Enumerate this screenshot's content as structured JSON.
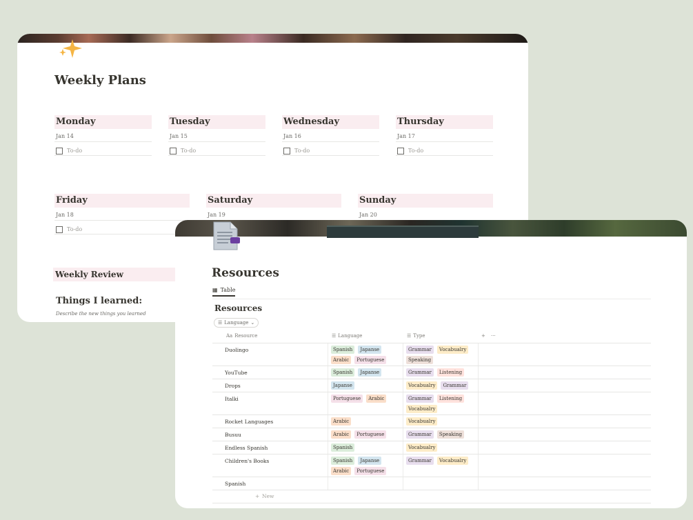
{
  "weekly": {
    "title": "Weekly Plans",
    "days": [
      {
        "name": "Monday",
        "date": "Jan 14",
        "todo": "To-do"
      },
      {
        "name": "Tuesday",
        "date": "Jan 15",
        "todo": "To-do"
      },
      {
        "name": "Wednesday",
        "date": "Jan 16",
        "todo": "To-do"
      },
      {
        "name": "Thursday",
        "date": "Jan 17",
        "todo": "To-do"
      },
      {
        "name": "Friday",
        "date": "Jan 18",
        "todo": "To-do"
      },
      {
        "name": "Saturday",
        "date": "Jan 19"
      },
      {
        "name": "Sunday",
        "date": "Jan 20"
      }
    ],
    "review_label": "Weekly Review",
    "learned_heading": "Things I learned:",
    "learned_placeholder": "Describe the new things you learned"
  },
  "resources": {
    "page_title": "Resources",
    "view_tab": "Table",
    "db_title": "Resources",
    "filter_label": "Language",
    "columns": {
      "name": "Resource",
      "language": "Language",
      "type": "Type",
      "name_icon": "Aa"
    },
    "new_label": "New",
    "rows": [
      {
        "name": "Duolingo",
        "language": [
          "Spanish",
          "Japanse",
          "Arabic",
          "Portuguese"
        ],
        "type": [
          "Grammar",
          "Vocabualry",
          "Speaking"
        ]
      },
      {
        "name": "YouTube",
        "language": [
          "Spanish",
          "Japanse"
        ],
        "type": [
          "Grammar",
          "Listening"
        ]
      },
      {
        "name": "Drops",
        "language": [
          "Japanse"
        ],
        "type": [
          "Vocabualry",
          "Grammar"
        ]
      },
      {
        "name": "Italki",
        "language": [
          "Portuguese",
          "Arabic"
        ],
        "type": [
          "Grammar",
          "Listening",
          "Vocabualry"
        ]
      },
      {
        "name": "Rocket Languages",
        "language": [
          "Arabic"
        ],
        "type": [
          "Vocabualry"
        ]
      },
      {
        "name": "Busuu",
        "language": [
          "Arabic",
          "Portuguese"
        ],
        "type": [
          "Grammar",
          "Speaking"
        ]
      },
      {
        "name": "Endless Spanish",
        "language": [
          "Spanish"
        ],
        "type": [
          "Vocabualry"
        ]
      },
      {
        "name": "Children's Books",
        "language": [
          "Spanish",
          "Japanse",
          "Arabic",
          "Portuguese"
        ],
        "type": [
          "Grammar",
          "Vocabualry"
        ]
      },
      {
        "name": "Spanish",
        "language": [],
        "type": []
      }
    ]
  },
  "tag_colors": {
    "Spanish": "#dbeddb",
    "Japanse": "#d3e5ef",
    "Arabic": "#fadec9",
    "Portuguese": "#f5e0e9",
    "Grammar": "#e8deee",
    "Vocabualry": "#fdecc8",
    "Speaking": "#eee0da",
    "Listening": "#ffe2dd"
  },
  "colors": {
    "day_header_bg": "#faedf0",
    "background": "#dde3d7"
  },
  "icons": {
    "sparkle": "sparkle-icon",
    "document": "document-icon",
    "table": "table-icon",
    "list": "list-icon"
  }
}
